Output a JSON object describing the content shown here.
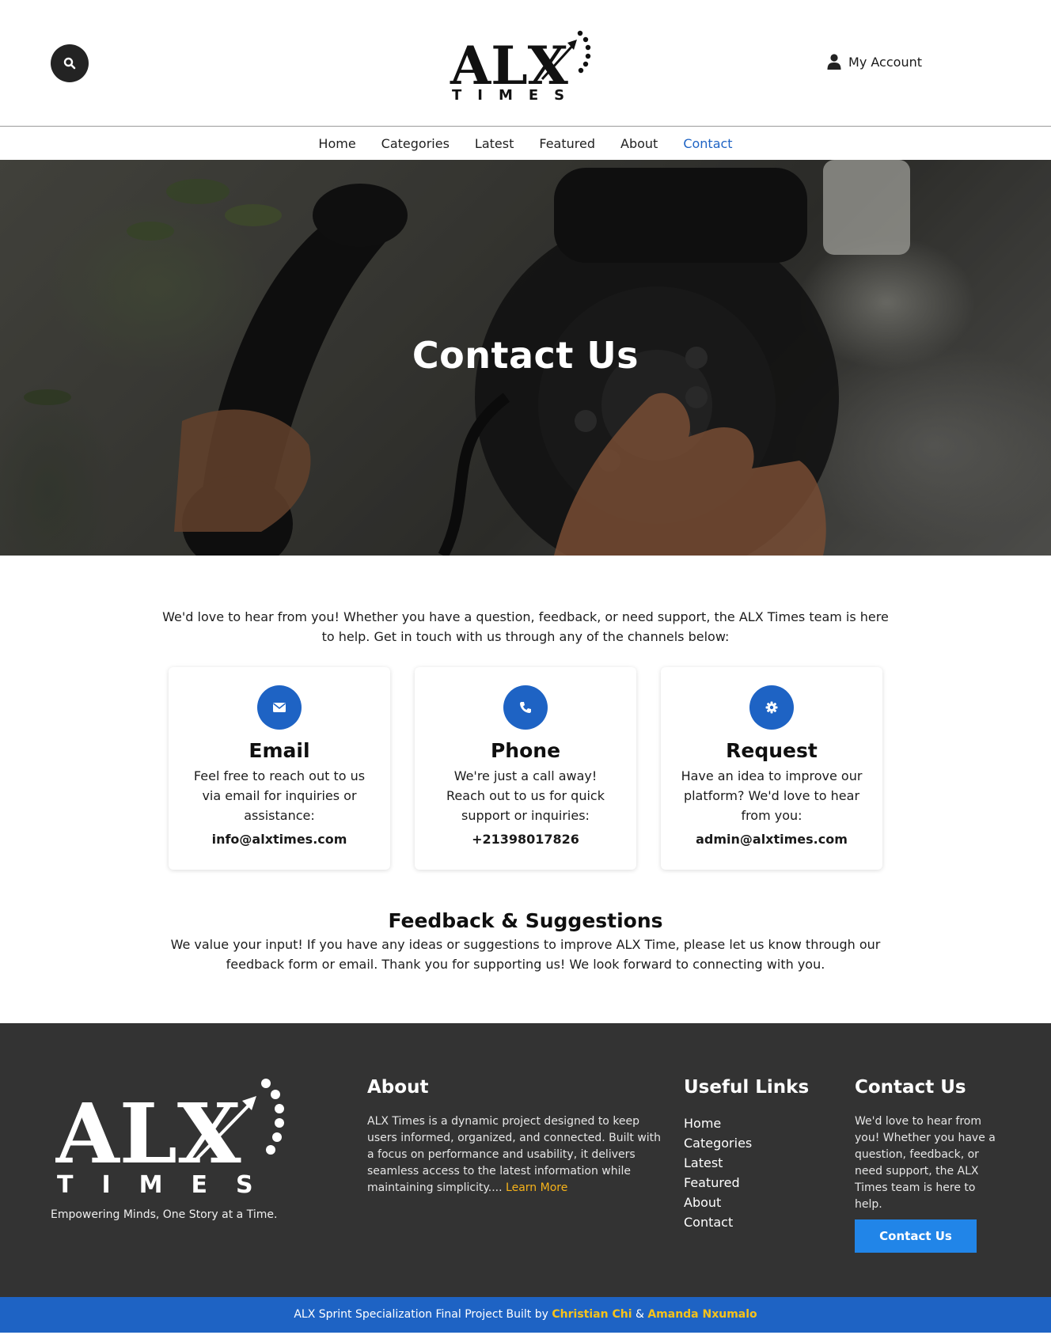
{
  "header": {
    "logo": {
      "main": "ALX",
      "sub": "TIMES"
    },
    "account_label": "My Account"
  },
  "nav": [
    {
      "label": "Home",
      "active": false
    },
    {
      "label": "Categories",
      "active": false
    },
    {
      "label": "Latest",
      "active": false
    },
    {
      "label": "Featured",
      "active": false
    },
    {
      "label": "About",
      "active": false
    },
    {
      "label": "Contact",
      "active": true
    }
  ],
  "hero": {
    "title": "Contact Us"
  },
  "intro": "We'd love to hear from you! Whether you have a question, feedback, or need support, the ALX Times team is here to help. Get in touch with us through any of the channels below:",
  "cards": [
    {
      "icon": "envelope-icon",
      "title": "Email",
      "text": "Feel free to reach out to us via email for inquiries or assistance:",
      "value": "info@alxtimes.com"
    },
    {
      "icon": "phone-icon",
      "title": "Phone",
      "text": "We're just a call away! Reach out to us for quick support or inquiries:",
      "value": "+21398017826"
    },
    {
      "icon": "gear-icon",
      "title": "Request",
      "text": "Have an idea to improve our platform? We'd love to hear from you:",
      "value": "admin@alxtimes.com"
    }
  ],
  "feedback": {
    "title": "Feedback & Suggestions",
    "text": "We value your input! If you have any ideas or suggestions to improve ALX Time, please let us know through our feedback form or email. Thank you for supporting us! We look forward to connecting with you."
  },
  "footer": {
    "logo": {
      "main": "ALX",
      "sub": "TIMES"
    },
    "tagline": "Empowering Minds, One Story at a Time.",
    "about": {
      "title": "About",
      "text": "ALX Times is a dynamic project designed to keep users informed, organized, and connected. Built with a focus on performance and usability, it delivers seamless access to the latest information while maintaining simplicity....",
      "learn_more": "Learn More"
    },
    "links": {
      "title": "Useful Links",
      "items": [
        "Home",
        "Categories",
        "Latest",
        "Featured",
        "About",
        "Contact"
      ]
    },
    "contact": {
      "title": "Contact Us",
      "text": "We'd love to hear from you! Whether you have a question, feedback, or need support, the ALX Times team is here to help.",
      "button": "Contact Us"
    }
  },
  "bottom_bar": {
    "prefix": "ALX Sprint Specialization Final Project Built by",
    "author1": "Christian Chi",
    "separator": "&",
    "author2": "Amanda Nxumalo"
  },
  "colors": {
    "accent": "#1e63c4",
    "footer_bg": "#333333",
    "highlight": "#f6b21a",
    "button": "#2185e8"
  }
}
